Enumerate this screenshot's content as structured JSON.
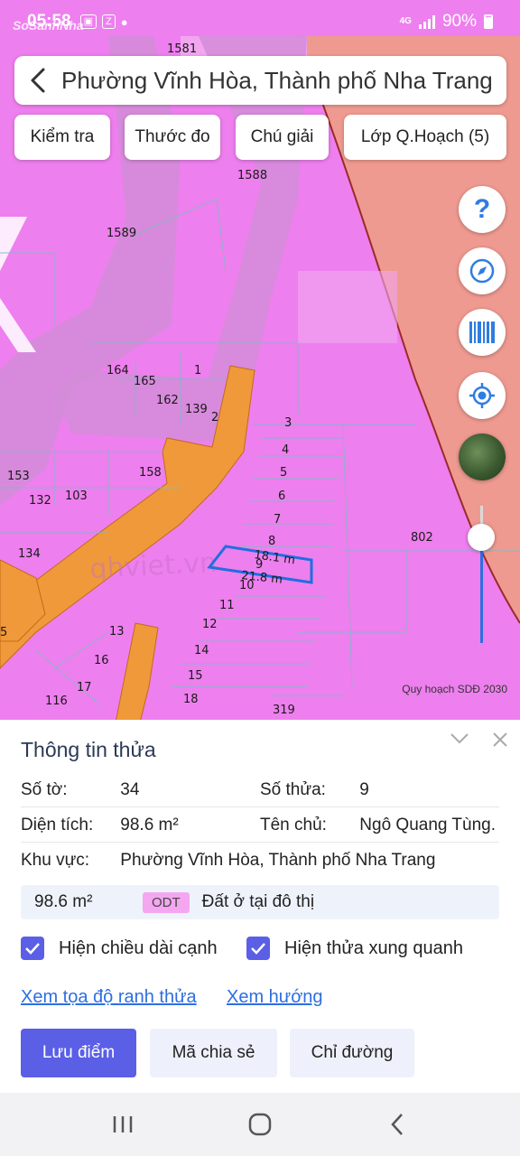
{
  "status_bar": {
    "time": "05:58",
    "battery": "90%",
    "network": "4G",
    "watermark": "SoSanhNha"
  },
  "search": {
    "title": "Phường Vĩnh Hòa, Thành phố Nha Trang"
  },
  "chips": [
    "Kiểm tra",
    "Thước đo",
    "Chú giải",
    "Lớp Q.Hoạch (5)"
  ],
  "map": {
    "plan_label": "Quy hoạch SDĐ 2030",
    "parcel_labels": [
      "1581",
      "1588",
      "1589",
      "164",
      "165",
      "1",
      "162",
      "139",
      "2",
      "3",
      "4",
      "5",
      "6",
      "7",
      "8",
      "9",
      "10",
      "11",
      "12",
      "13",
      "14",
      "15",
      "16",
      "17",
      "18",
      "116",
      "153",
      "158",
      "132",
      "103",
      "134",
      "802",
      "319",
      "5"
    ],
    "edge_labels": [
      "18.1 m",
      "21.8 m"
    ],
    "faint_watermark": "qhviet.vn",
    "colors": {
      "residential": "#ee7fee",
      "green_zone": "#ef9a90",
      "road": "#f0993a",
      "highlight": "#1f6fe0"
    }
  },
  "side_buttons": [
    "help-icon",
    "compass-icon",
    "barcode-icon",
    "locate-icon",
    "satellite-layer-icon"
  ],
  "panel": {
    "title": "Thông tin thửa",
    "so_to_label": "Số tờ:",
    "so_to_value": "34",
    "so_thua_label": "Số thửa:",
    "so_thua_value": "9",
    "dien_tich_label": "Diện tích:",
    "dien_tich_value": "98.6 m²",
    "ten_chu_label": "Tên chủ:",
    "ten_chu_value": "Ngô Quang Tùng.",
    "khu_vuc_label": "Khu vực:",
    "khu_vuc_value": "Phường Vĩnh Hòa, Thành phố Nha Trang",
    "usage_area": "98.6 m²",
    "usage_code": "ODT",
    "usage_desc": "Đất ở tại đô thị",
    "checkbox_edges": "Hiện chiều dài cạnh",
    "checkbox_neighbors": "Hiện thửa xung quanh",
    "link_coords": "Xem tọa độ ranh thửa",
    "link_direction": "Xem hướng",
    "btn_save": "Lưu điểm",
    "btn_share": "Mã chia sẻ",
    "btn_route": "Chỉ đường"
  }
}
